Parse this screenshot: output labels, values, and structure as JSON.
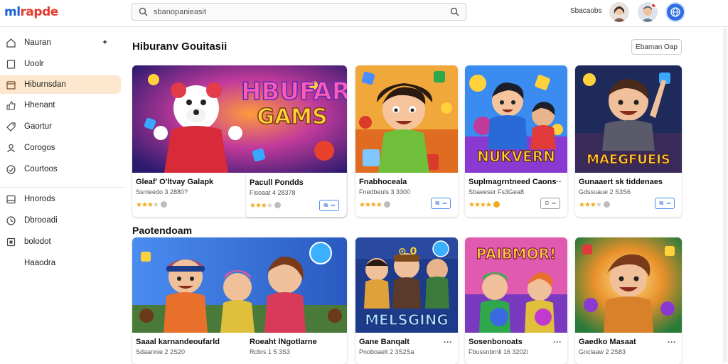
{
  "logo": {
    "part1": "ml",
    "part2": "rapde"
  },
  "search": {
    "placeholder": "sbanopanieasit"
  },
  "user": {
    "label": "Sbacaobs"
  },
  "sidebar": {
    "items": [
      {
        "label": "Nauran",
        "icon": "home-icon",
        "pin": "✦"
      },
      {
        "label": "Uoolr",
        "icon": "bookmark-icon"
      },
      {
        "label": "Hiburnsdan",
        "icon": "folder-icon"
      },
      {
        "label": "Hhenant",
        "icon": "thumbs-up-icon"
      },
      {
        "label": "Gaortur",
        "icon": "tag-icon"
      },
      {
        "label": "Corogos",
        "icon": "user-icon"
      },
      {
        "label": "Courtoos",
        "icon": "cloud-icon"
      },
      {
        "label": "Hnorods",
        "icon": "inbox-icon"
      },
      {
        "label": "Dbrooadi",
        "icon": "clock-icon"
      },
      {
        "label": "bolodot",
        "icon": "calendar-icon"
      },
      {
        "label": "Haaodra"
      }
    ]
  },
  "main": {
    "section1_title": "Hiburanv Gouitasii",
    "section1_button": "Ebaman Oap",
    "section2_title": "Paotendoam",
    "cards_row1": [
      {
        "title": "Gleaf' O'ltvay Galapk",
        "subtitle": "Ssmeedo 3 2880?",
        "rating": 3,
        "button": "⧉ ▭",
        "art": "HBUFAR GAMS"
      },
      {
        "title": "Pacull Pondds",
        "subtitle": "Fisoaat 4 28378",
        "rating": 3,
        "button": "⧉ ▭"
      },
      {
        "title": "Fnabhoceala",
        "subtitle": "Fnedbeuls 3 3300",
        "rating": 4,
        "button": "⧉ ▭"
      },
      {
        "title": "Suplmagrntneed Caons",
        "subtitle": "Sbaeeser Fs3Gea8",
        "rating": 4,
        "button": "⊡ ▭",
        "art": "NUKVERN",
        "more": "···"
      },
      {
        "title": "Gunaaert sk tiddenaes",
        "subtitle": "Gdssuaue 2 S3S6",
        "rating": 3,
        "button": "⧉ ▭",
        "art": "MAEGFUEIS"
      }
    ],
    "cards_row2": [
      {
        "title": "Saaal karnandeoufarld",
        "subtitle": "Sdaannie 2 2S20",
        "art": ""
      },
      {
        "title": "Roeaht lNgotlarne",
        "subtitle": "Rcbrs 1 5 3S3",
        "art": ""
      },
      {
        "title": "Gane Banqalt",
        "subtitle": "Pnoboaelt 2 3S2Sa",
        "art": "MELSGING",
        "more": "···"
      },
      {
        "title": "Sosenbonoats",
        "subtitle": "Fbussnbrnli 16 3202l",
        "art": "PAIBMOR!",
        "more": "···"
      },
      {
        "title": "Gaedko Masaat",
        "subtitle": "Gnclaaw 2 2S83",
        "art": "",
        "more": "···"
      }
    ]
  },
  "colors": {
    "accent": "#1a5fd1",
    "active_bg": "#fde7cf",
    "star": "#f2a91d",
    "logo_red": "#e33b2e"
  }
}
